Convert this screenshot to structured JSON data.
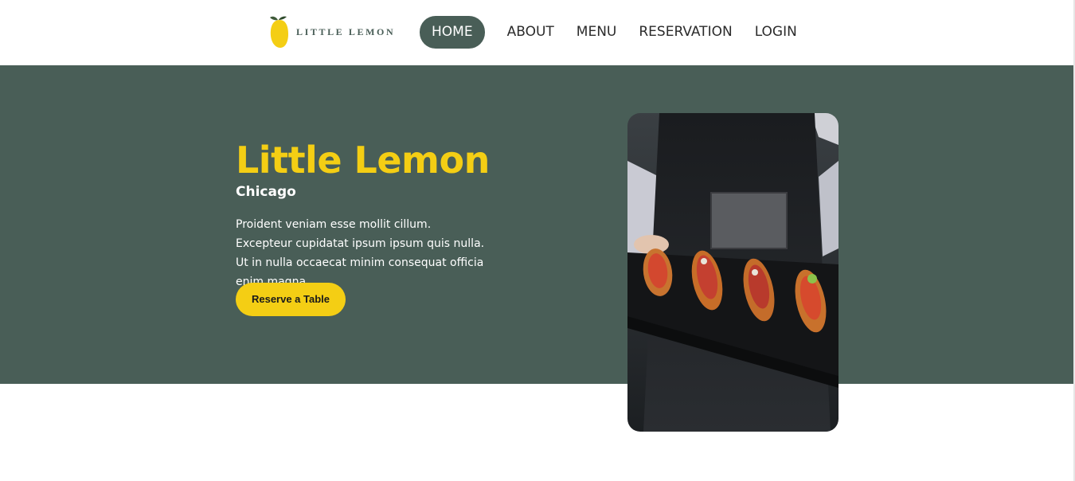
{
  "brand": {
    "name": "LITTLE LEMON"
  },
  "nav": {
    "items": [
      {
        "label": "HOME",
        "active": true
      },
      {
        "label": "ABOUT",
        "active": false
      },
      {
        "label": "MENU",
        "active": false
      },
      {
        "label": "RESERVATION",
        "active": false
      },
      {
        "label": "LOGIN",
        "active": false
      }
    ]
  },
  "hero": {
    "title": "Little Lemon",
    "subtitle": "Chicago",
    "description": "Proident veniam esse mollit cillum. Excepteur cupidatat ipsum ipsum quis nulla. Ut in nulla occaecat minim consequat officia enim magna.",
    "cta_label": "Reserve a Table",
    "image_icon": "food-platter-photo"
  },
  "colors": {
    "primary": "#495e57",
    "accent": "#f4ce14",
    "text_dark": "#2b2b2b",
    "background": "#ffffff"
  }
}
